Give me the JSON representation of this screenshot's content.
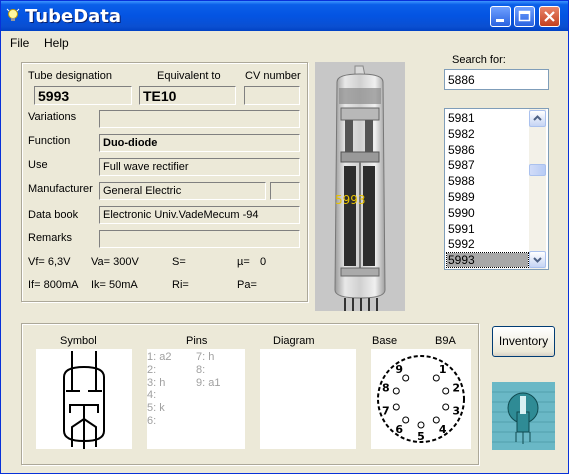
{
  "window": {
    "title": "TubeData"
  },
  "menu": {
    "file": "File",
    "help": "Help"
  },
  "tube": {
    "designation_label": "Tube designation",
    "designation": "5993",
    "equivalent_label": "Equivalent to",
    "equivalent": "TE10",
    "cv_label": "CV number",
    "cv": "",
    "variations_label": "Variations",
    "variations": "",
    "function_label": "Function",
    "function": "Duo-diode",
    "use_label": "Use",
    "use": "Full wave rectifier",
    "manufacturer_label": "Manufacturer",
    "manufacturer": "General Electric",
    "manufacturer_code": "",
    "databook_label": "Data book",
    "databook": "Electronic Univ.VadeMecum -94",
    "remarks_label": "Remarks",
    "remarks": "",
    "specs": {
      "vf": "Vf= 6,3V",
      "va": "Va= 300V",
      "s": "S=",
      "mu": "µ=",
      "mu_val": "0",
      "if": "If= 800mA",
      "ik": "Ik=  50mA",
      "ri": "Ri=",
      "pa": "Pa="
    },
    "photo_label": "5993"
  },
  "search": {
    "label": "Search for:",
    "value": "5886",
    "items": [
      "5981",
      "5982",
      "5986",
      "5987",
      "5988",
      "5989",
      "5990",
      "5991",
      "5992",
      "5993"
    ],
    "selected": "5993"
  },
  "bottom": {
    "symbol_label": "Symbol",
    "pins_label": "Pins",
    "diagram_label": "Diagram",
    "base_label": "Base",
    "base_type": "B9A",
    "pins_left": [
      "1: a2",
      "2:",
      "3: h",
      "4:",
      "5: k",
      "6:"
    ],
    "pins_right": [
      "7: h",
      "8:",
      "9: a1"
    ],
    "base_numbers": [
      "1",
      "2",
      "3",
      "4",
      "5",
      "6",
      "7",
      "8",
      "9"
    ]
  },
  "buttons": {
    "inventory": "Inventory"
  }
}
